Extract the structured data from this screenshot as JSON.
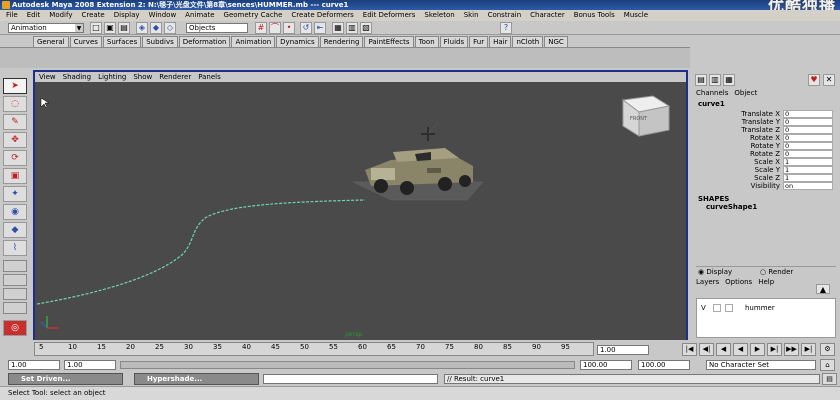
{
  "title_bar": {
    "title": "Autodesk Maya 2008 Extension 2: N:\\毯子\\光盘文件\\第8章\\sences\\HUMMER.mb   ---   curve1"
  },
  "watermark": "优酷独播",
  "menu": [
    "File",
    "Edit",
    "Modify",
    "Create",
    "Display",
    "Window",
    "Animate",
    "Geometry Cache",
    "Create Deformers",
    "Edit Deformers",
    "Skeleton",
    "Skin",
    "Constrain",
    "Character",
    "Bonus Tools",
    "Muscle"
  ],
  "status_line": {
    "mode": "Animation",
    "object_field": "Objects"
  },
  "shelf_tabs": [
    "General",
    "Curves",
    "Surfaces",
    "Subdivs",
    "Deformation",
    "Animation",
    "Dynamics",
    "Rendering",
    "PaintEffects",
    "Toon",
    "Fluids",
    "Fur",
    "Hair",
    "nCloth",
    "NGC"
  ],
  "viewport": {
    "menu": [
      "View",
      "Shading",
      "Lighting",
      "Show",
      "Renderer",
      "Panels"
    ],
    "camera_label": "persp",
    "viewcube_label": "FRONT"
  },
  "channel_box": {
    "tabs": [
      "Channels",
      "Object"
    ],
    "object_name": "curve1",
    "attributes": [
      {
        "label": "Translate X",
        "value": "0"
      },
      {
        "label": "Translate Y",
        "value": "0"
      },
      {
        "label": "Translate Z",
        "value": "0"
      },
      {
        "label": "Rotate X",
        "value": "0"
      },
      {
        "label": "Rotate Y",
        "value": "0"
      },
      {
        "label": "Rotate Z",
        "value": "0"
      },
      {
        "label": "Scale X",
        "value": "1"
      },
      {
        "label": "Scale Y",
        "value": "1"
      },
      {
        "label": "Scale Z",
        "value": "1"
      },
      {
        "label": "Visibility",
        "value": "on"
      }
    ],
    "shapes_header": "SHAPES",
    "shape_name": "curveShape1"
  },
  "layer_editor": {
    "display_option": "Display",
    "render_option": "Render",
    "menu": [
      "Layers",
      "Options",
      "Help"
    ],
    "layer_v": "V",
    "layer_name": "hummer"
  },
  "time_slider": {
    "ticks": [
      "5",
      "10",
      "15",
      "20",
      "25",
      "30",
      "35",
      "40",
      "45",
      "50",
      "55",
      "60",
      "65",
      "70",
      "75",
      "80",
      "85",
      "90",
      "95"
    ],
    "current_frame": "1.00"
  },
  "range_slider": {
    "start": "1.00",
    "inner_start": "1.00",
    "inner_end": "100.00",
    "end": "100.00",
    "character_set": "No Character Set"
  },
  "command_line": {
    "task1": "Set Driven...",
    "task2": "Hypershade...",
    "result": "// Result: curve1"
  },
  "help_line": "Select Tool: select an object",
  "colors": {
    "title_bar": "#1c3f7c",
    "viewport_bg": "#4a4a4a",
    "active_border": "#1c2f8a",
    "curve": "#6fd3b8"
  }
}
